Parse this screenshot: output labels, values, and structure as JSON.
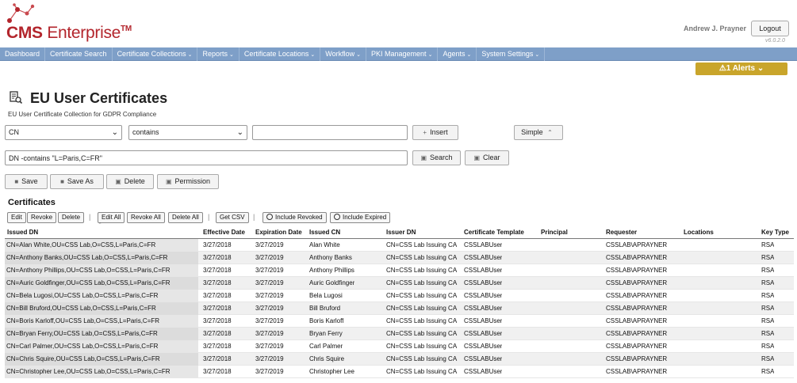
{
  "header": {
    "logo_brand": "CMS",
    "logo_product": "Enterprise",
    "logo_tm": "TM",
    "user_name": "Andrew J. Prayner",
    "logout_label": "Logout",
    "version": "v6.0.2.0"
  },
  "nav": [
    {
      "label": "Dashboard",
      "caret": ""
    },
    {
      "label": "Certificate Search",
      "caret": ""
    },
    {
      "label": "Certificate Collections",
      "caret": "⌄"
    },
    {
      "label": "Reports",
      "caret": "⌄"
    },
    {
      "label": "Certificate Locations",
      "caret": "⌄"
    },
    {
      "label": "Workflow",
      "caret": "⌄"
    },
    {
      "label": "PKI Management",
      "caret": "⌄"
    },
    {
      "label": "Agents",
      "caret": "⌄"
    },
    {
      "label": "System Settings",
      "caret": "⌄"
    }
  ],
  "alerts": {
    "label": "⚠1 Alerts ⌄"
  },
  "page": {
    "title": "EU User Certificates",
    "subtitle": "EU User Certificate Collection for GDPR Compliance"
  },
  "filter": {
    "field_value": "CN",
    "operator_value": "contains",
    "term_value": "",
    "insert_label": "Insert",
    "simple_label": "Simple",
    "query_value": "DN -contains \"L=Paris,C=FR\"",
    "search_label": "Search",
    "clear_label": "Clear"
  },
  "actions": {
    "save": "Save",
    "save_as": "Save As",
    "delete": "Delete",
    "permission": "Permission"
  },
  "certificates": {
    "section_title": "Certificates",
    "toolbar": {
      "edit": "Edit",
      "revoke": "Revoke",
      "delete": "Delete",
      "edit_all": "Edit All",
      "revoke_all": "Revoke All",
      "delete_all": "Delete All",
      "get_csv": "Get CSV",
      "include_revoked": "Include Revoked",
      "include_expired": "Include Expired"
    },
    "columns": [
      "Issued DN",
      "Effective Date",
      "Expiration Date",
      "Issued CN",
      "Issuer DN",
      "Certificate Template",
      "Principal",
      "Requester",
      "Locations",
      "Key Type"
    ],
    "rows": [
      [
        "CN=Alan White,OU=CSS Lab,O=CSS,L=Paris,C=FR",
        "3/27/2018",
        "3/27/2019",
        "Alan White",
        "CN=CSS Lab Issuing CA",
        "CSSLABUser",
        "",
        "CSSLAB\\APRAYNER",
        "",
        "RSA"
      ],
      [
        "CN=Anthony Banks,OU=CSS Lab,O=CSS,L=Paris,C=FR",
        "3/27/2018",
        "3/27/2019",
        "Anthony Banks",
        "CN=CSS Lab Issuing CA",
        "CSSLABUser",
        "",
        "CSSLAB\\APRAYNER",
        "",
        "RSA"
      ],
      [
        "CN=Anthony Phillips,OU=CSS Lab,O=CSS,L=Paris,C=FR",
        "3/27/2018",
        "3/27/2019",
        "Anthony Phillips",
        "CN=CSS Lab Issuing CA",
        "CSSLABUser",
        "",
        "CSSLAB\\APRAYNER",
        "",
        "RSA"
      ],
      [
        "CN=Auric Goldfinger,OU=CSS Lab,O=CSS,L=Paris,C=FR",
        "3/27/2018",
        "3/27/2019",
        "Auric Goldfinger",
        "CN=CSS Lab Issuing CA",
        "CSSLABUser",
        "",
        "CSSLAB\\APRAYNER",
        "",
        "RSA"
      ],
      [
        "CN=Bela Lugosi,OU=CSS Lab,O=CSS,L=Paris,C=FR",
        "3/27/2018",
        "3/27/2019",
        "Bela Lugosi",
        "CN=CSS Lab Issuing CA",
        "CSSLABUser",
        "",
        "CSSLAB\\APRAYNER",
        "",
        "RSA"
      ],
      [
        "CN=Bill Bruford,OU=CSS Lab,O=CSS,L=Paris,C=FR",
        "3/27/2018",
        "3/27/2019",
        "Bill Bruford",
        "CN=CSS Lab Issuing CA",
        "CSSLABUser",
        "",
        "CSSLAB\\APRAYNER",
        "",
        "RSA"
      ],
      [
        "CN=Boris Karloff,OU=CSS Lab,O=CSS,L=Paris,C=FR",
        "3/27/2018",
        "3/27/2019",
        "Boris Karloff",
        "CN=CSS Lab Issuing CA",
        "CSSLABUser",
        "",
        "CSSLAB\\APRAYNER",
        "",
        "RSA"
      ],
      [
        "CN=Bryan Ferry,OU=CSS Lab,O=CSS,L=Paris,C=FR",
        "3/27/2018",
        "3/27/2019",
        "Bryan Ferry",
        "CN=CSS Lab Issuing CA",
        "CSSLABUser",
        "",
        "CSSLAB\\APRAYNER",
        "",
        "RSA"
      ],
      [
        "CN=Carl Palmer,OU=CSS Lab,O=CSS,L=Paris,C=FR",
        "3/27/2018",
        "3/27/2019",
        "Carl Palmer",
        "CN=CSS Lab Issuing CA",
        "CSSLABUser",
        "",
        "CSSLAB\\APRAYNER",
        "",
        "RSA"
      ],
      [
        "CN=Chris Squire,OU=CSS Lab,O=CSS,L=Paris,C=FR",
        "3/27/2018",
        "3/27/2019",
        "Chris Squire",
        "CN=CSS Lab Issuing CA",
        "CSSLABUser",
        "",
        "CSSLAB\\APRAYNER",
        "",
        "RSA"
      ],
      [
        "CN=Christopher Lee,OU=CSS Lab,O=CSS,L=Paris,C=FR",
        "3/27/2018",
        "3/27/2019",
        "Christopher Lee",
        "CN=CSS Lab Issuing CA",
        "CSSLABUser",
        "",
        "CSSLAB\\APRAYNER",
        "",
        "RSA"
      ]
    ]
  },
  "colors": {
    "brand_red": "#b3252c",
    "nav_blue": "#7e9fc8",
    "alert_gold": "#c9a52b"
  },
  "icons": {
    "logo": "molecule-icon",
    "title": "certificate-search-icon",
    "insert": "plus-icon",
    "search": "search-icon",
    "clear": "clear-icon",
    "save": "save-icon",
    "save_as": "save-as-icon",
    "delete": "trash-icon",
    "permission": "lock-icon"
  }
}
